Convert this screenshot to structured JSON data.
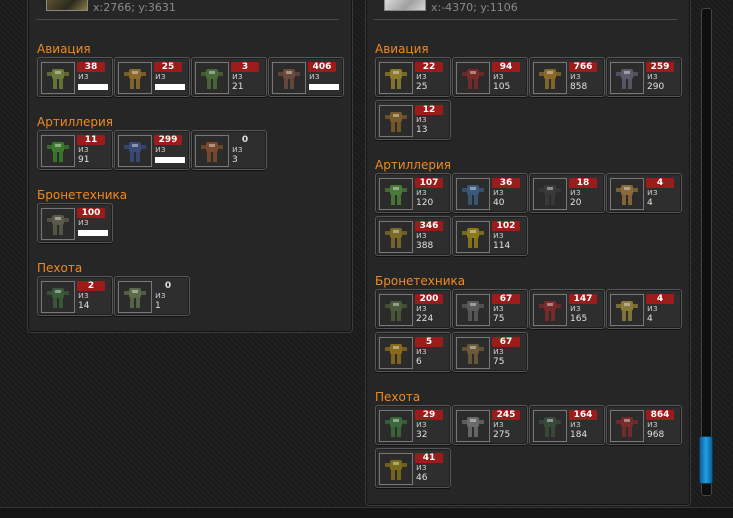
{
  "colors": {
    "accent": "#f08a1e",
    "badge": "#9c1b1b",
    "scroll": "#1fa0e0"
  },
  "left": {
    "coords": "x:2766; y:3631",
    "sections": [
      {
        "title": "Авиация",
        "units": [
          {
            "have": "38",
            "of": "из",
            "total": "",
            "hidden": true,
            "tint": "#6a7a3a"
          },
          {
            "have": "25",
            "of": "из",
            "total": "",
            "hidden": true,
            "tint": "#8a6a2a"
          },
          {
            "have": "3",
            "of": "из",
            "total": "21",
            "hidden": false,
            "tint": "#4a6a3a"
          },
          {
            "have": "406",
            "of": "из",
            "total": "",
            "hidden": true,
            "tint": "#6a4a3a"
          }
        ]
      },
      {
        "title": "Артиллерия",
        "units": [
          {
            "have": "11",
            "of": "из",
            "total": "91",
            "hidden": false,
            "tint": "#3a7a2a"
          },
          {
            "have": "299",
            "of": "из",
            "total": "",
            "hidden": true,
            "tint": "#3a4a7a"
          },
          {
            "have": "0",
            "of": "из",
            "total": "3",
            "hidden": false,
            "plain": true,
            "tint": "#7a4a2a"
          }
        ]
      },
      {
        "title": "Бронетехника",
        "units": [
          {
            "have": "100",
            "of": "из",
            "total": "",
            "hidden": true,
            "tint": "#5a5a4a"
          }
        ]
      },
      {
        "title": "Пехота",
        "units": [
          {
            "have": "2",
            "of": "из",
            "total": "14",
            "hidden": false,
            "tint": "#3a5a3a"
          },
          {
            "have": "0",
            "of": "из",
            "total": "1",
            "hidden": false,
            "plain": true,
            "tint": "#5a6a4a"
          }
        ]
      }
    ]
  },
  "right": {
    "coords": "x:-4370; y:1106",
    "sections": [
      {
        "title": "Авиация",
        "units": [
          {
            "have": "22",
            "of": "из",
            "total": "25",
            "tint": "#8a7a2a"
          },
          {
            "have": "94",
            "of": "из",
            "total": "105",
            "tint": "#7a2a2a"
          },
          {
            "have": "766",
            "of": "из",
            "total": "858",
            "tint": "#8a6a2a"
          },
          {
            "have": "259",
            "of": "из",
            "total": "290",
            "tint": "#5a5a6a"
          },
          {
            "have": "12",
            "of": "из",
            "total": "13",
            "tint": "#7a5a2a"
          }
        ]
      },
      {
        "title": "Артиллерия",
        "units": [
          {
            "have": "107",
            "of": "из",
            "total": "120",
            "tint": "#4a7a3a"
          },
          {
            "have": "36",
            "of": "из",
            "total": "40",
            "tint": "#3a5a7a"
          },
          {
            "have": "18",
            "of": "из",
            "total": "20",
            "tint": "#3a3a3a"
          },
          {
            "have": "4",
            "of": "из",
            "total": "4",
            "tint": "#8a6a3a"
          },
          {
            "have": "346",
            "of": "из",
            "total": "388",
            "tint": "#7a6a2a"
          },
          {
            "have": "102",
            "of": "из",
            "total": "114",
            "tint": "#8a7a1a"
          }
        ]
      },
      {
        "title": "Бронетехника",
        "units": [
          {
            "have": "200",
            "of": "из",
            "total": "224",
            "tint": "#4a5a3a"
          },
          {
            "have": "67",
            "of": "из",
            "total": "75",
            "tint": "#5a5a5a"
          },
          {
            "have": "147",
            "of": "из",
            "total": "165",
            "tint": "#7a2a2a"
          },
          {
            "have": "4",
            "of": "из",
            "total": "4",
            "tint": "#8a7a3a"
          },
          {
            "have": "5",
            "of": "из",
            "total": "6",
            "tint": "#8a6a1a"
          },
          {
            "have": "67",
            "of": "из",
            "total": "75",
            "tint": "#6a5a3a"
          }
        ]
      },
      {
        "title": "Пехота",
        "units": [
          {
            "have": "29",
            "of": "из",
            "total": "32",
            "tint": "#3a6a3a"
          },
          {
            "have": "245",
            "of": "из",
            "total": "275",
            "tint": "#6a6a6a"
          },
          {
            "have": "164",
            "of": "из",
            "total": "184",
            "tint": "#3a4a3a"
          },
          {
            "have": "864",
            "of": "из",
            "total": "968",
            "tint": "#7a2a2a"
          },
          {
            "have": "41",
            "of": "из",
            "total": "46",
            "tint": "#7a6a1a"
          }
        ]
      }
    ]
  }
}
